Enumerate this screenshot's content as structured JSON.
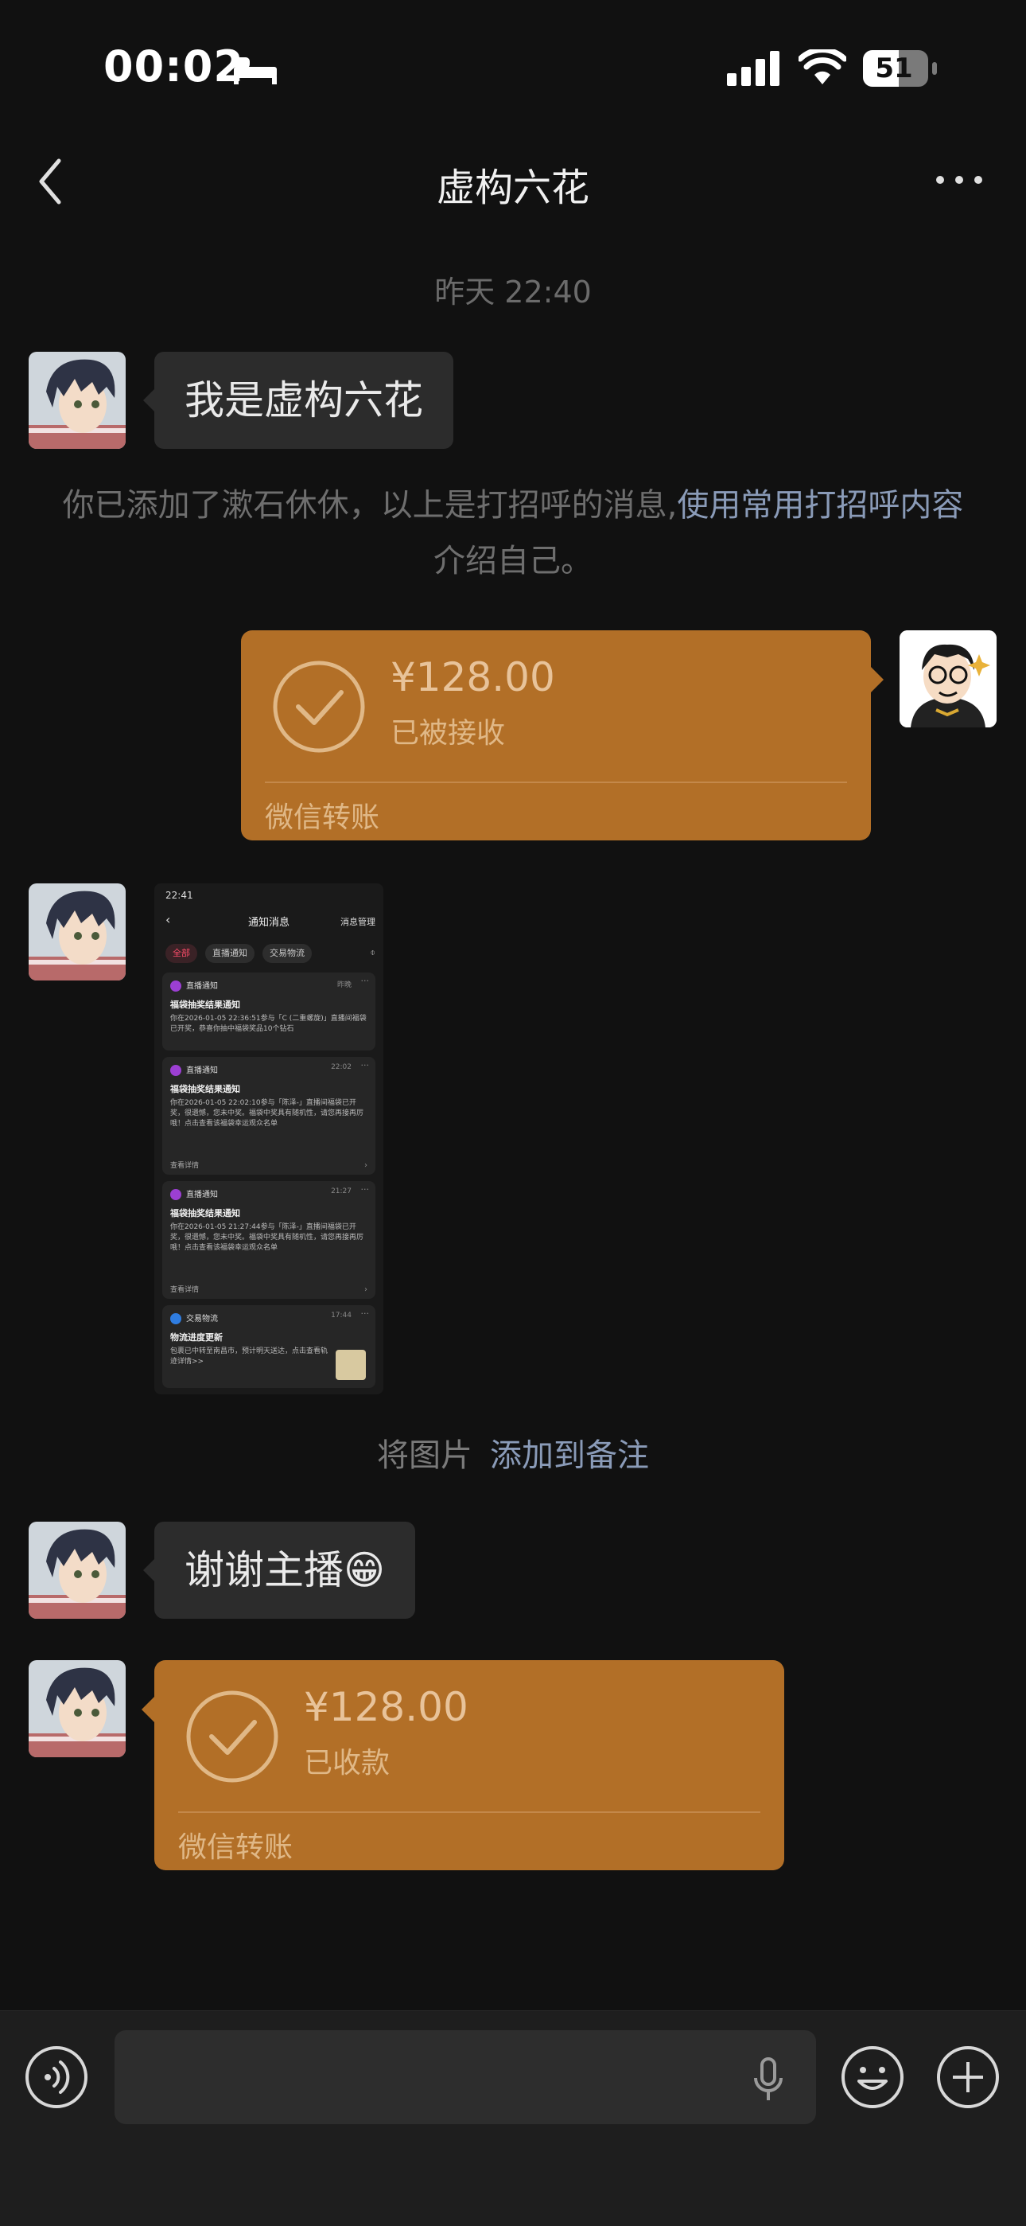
{
  "status_bar": {
    "time": "00:02",
    "battery": "51"
  },
  "header": {
    "title": "虚构六花"
  },
  "timestamp": "昨天 22:40",
  "messages": {
    "greeting": "我是虚构六花",
    "system_prefix": "你已添加了漱石休休，以上是打招呼的消息,",
    "system_link": "使用常用打招呼内容",
    "system_suffix": "介绍自己。",
    "transfer_out": {
      "amount": "¥128.00",
      "status": "已被接收",
      "brand": "微信转账"
    },
    "note_prefix": "将图片",
    "note_link": "添加到备注",
    "thanks": "谢谢主播😁",
    "transfer_in": {
      "amount": "¥128.00",
      "status": "已收款",
      "brand": "微信转账"
    }
  },
  "screenshot": {
    "status_time": "22:41",
    "title": "通知消息",
    "manage": "消息管理",
    "chips": [
      "全部",
      "直播通知",
      "交易物流"
    ],
    "cards": [
      {
        "header": "直播通知",
        "tag": "昨晚",
        "title": "福袋抽奖结果通知",
        "body": "你在2026-01-05 22:36:51参与「C (二重螺旋)」直播间福袋已开奖，恭喜你抽中福袋奖品10个钻石",
        "more": ""
      },
      {
        "header": "直播通知",
        "tag": "22:02",
        "title": "福袋抽奖结果通知",
        "body": "你在2026-01-05 22:02:10参与「陈泽-」直播间福袋已开奖，很遗憾，您未中奖。福袋中奖具有随机性，请您再接再厉哦！点击查看该福袋幸运观众名单",
        "more": "查看详情"
      },
      {
        "header": "直播通知",
        "tag": "21:27",
        "title": "福袋抽奖结果通知",
        "body": "你在2026-01-05 21:27:44参与「陈泽-」直播间福袋已开奖，很遗憾，您未中奖。福袋中奖具有随机性，请您再接再厉哦！点击查看该福袋幸运观众名单",
        "more": "查看详情"
      },
      {
        "header": "交易物流",
        "tag": "17:44",
        "title": "物流进度更新",
        "body": "包裹已中转至南昌市，预计明天送达，点击查看轨迹详情>>",
        "more": ""
      }
    ]
  },
  "icons": {
    "back": "chevron-left-icon",
    "more": "ellipsis-icon",
    "voice": "voice-icon",
    "mic": "microphone-icon",
    "emoji": "emoji-icon",
    "plus": "plus-icon"
  },
  "colors": {
    "background": "#111111",
    "transfer": "#b26f27",
    "link": "#8a9bb8",
    "bubble": "#2c2c2c"
  }
}
